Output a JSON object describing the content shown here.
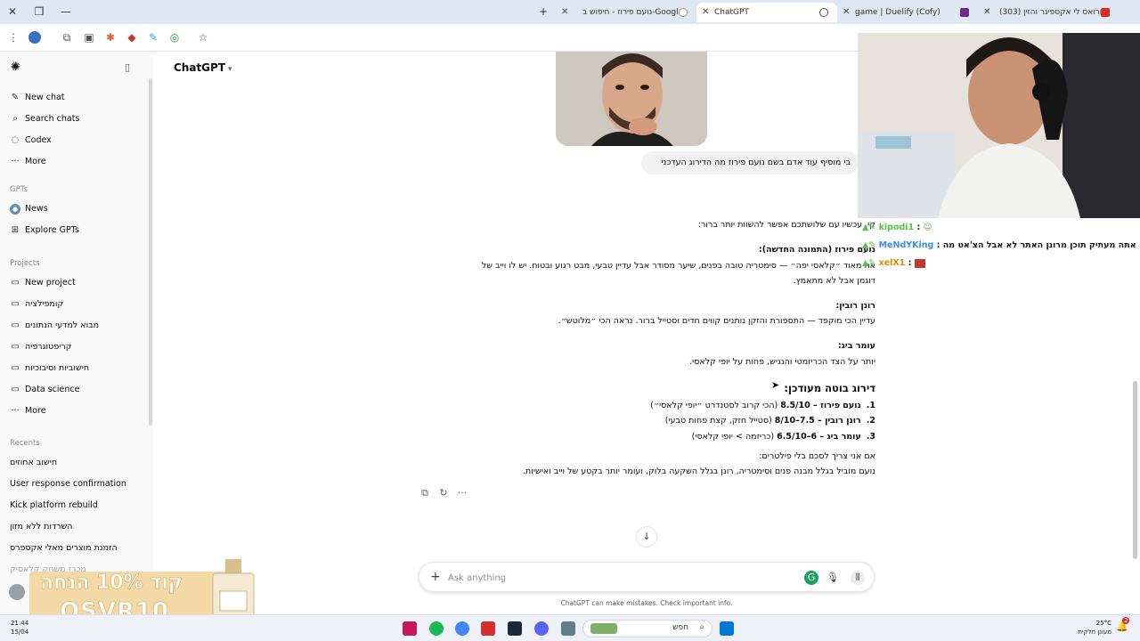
{
  "browser": {
    "tabs": [
      {
        "title": "נועם פירוז - חיפוש ב-Google",
        "active": false
      },
      {
        "title": "ChatGPT",
        "active": true
      },
      {
        "title": "game | Duelify (Cofy)",
        "active": false
      },
      {
        "title": "(303) קורואס לי אקספיגר והזין",
        "active": false
      }
    ]
  },
  "sidebar": {
    "top_items": [
      {
        "label": "New chat",
        "icon": "edit-icon"
      },
      {
        "label": "Search chats",
        "icon": "search-icon"
      },
      {
        "label": "Codex",
        "icon": "codex-icon"
      },
      {
        "label": "More",
        "icon": "more-icon"
      }
    ],
    "gpts_heading": "GPTs",
    "gpts": [
      {
        "label": "News"
      },
      {
        "label": "Explore GPTs"
      }
    ],
    "projects_heading": "Projects",
    "projects": [
      {
        "label": "New project"
      },
      {
        "label": "קומפילציה"
      },
      {
        "label": "מבוא למדעי הנתונים"
      },
      {
        "label": "קריפטוגרפיה"
      },
      {
        "label": "חישוביות וסיבוכיות"
      },
      {
        "label": "Data science"
      },
      {
        "label": "More"
      }
    ],
    "recents_heading": "Recents",
    "recents": [
      "חישוב אחוזים",
      "User response confirmation",
      "Kick platform rebuild",
      "השרדות ללא מזון",
      "הזמנת מוצרים מאלי אקספרס",
      "מכרז משחק קלאסיק"
    ]
  },
  "header": {
    "title": "ChatGPT"
  },
  "conversation": {
    "user_message": "בי מוסיף עוד אדם בשם נועם פירוז מה הדירוג העדכני",
    "assistant": {
      "intro": "קי, עכשיו עם שלושתכם אפשר להשוות יותר ברור:",
      "p1_title": "נועם פירוז (התמונה החדשה):",
      "p1_line1": "אה מאוד ״קלאסי יפה״ — סימטריה טובה בפנים, שיער מסודר אבל עדיין טבעי, מבט רגוע ובטוח. יש לו וייב של",
      "p1_line2": "דוגמן אבל לא מתאמץ.",
      "p2_title": "רונן רובין:",
      "p2_line1": "עדיין הכי מוקפד — התספורת והזקן נותנים קווים חדים וסטייל ברור. נראה הכי ״מלוטש״.",
      "p3_title": "עומר ביג:",
      "p3_line1": "יותר על הצד הכריזמטי והנגיש, פחות על יופי קלאסי.",
      "ranking_title": "דירוג בוטה מעודכן:",
      "ranking": [
        {
          "num": "1.",
          "name": "נועם פירוז – 8.5/10",
          "note": "(הכי קרוב לסטנדרט ״יופי קלאסי״)"
        },
        {
          "num": "2.",
          "name": "רונן רובין – 7.5–8/10",
          "note": "(סטייל חזק, קצת פחות טבעי)"
        },
        {
          "num": "3.",
          "name": "עומר ביג – 6–6.5/10",
          "note": "(כריזמה > יופי קלאסי)"
        }
      ],
      "summary_line1": "אם אני צריך לסכם בלי פילטרים:",
      "summary_line2": "נועם מוביל בגלל מבנה פנים וסימטריה, רונן בגלל השקעה בלוק, ועומר יותר בקטע של וייב ואישיות."
    }
  },
  "composer": {
    "placeholder": "Ask anything",
    "disclaimer": "ChatGPT can make mistakes. Check important info."
  },
  "stream_chat": [
    {
      "user": "kipodi1",
      "message": "",
      "color": "#53c24a"
    },
    {
      "user": "MeNdYKing",
      "message": "זה אתה מעתיק תוכן מרונן האתר לא אבל הצ'אט מה",
      "color": "#3a8ee6"
    },
    {
      "user": "xelX1",
      "message": "",
      "color": "#e08a00"
    }
  ],
  "promo": {
    "line1": "קוד 10% הנחה",
    "line2": "OSVR10"
  },
  "taskbar": {
    "time": "21:44",
    "date": "15/04",
    "search_label": "חפש",
    "weather_temp": "25°C",
    "weather_desc": "מעונן חלקית",
    "notifications": "2"
  },
  "colors": {
    "sidebar_bg": "#f9f9f9",
    "bubble_bg": "#f2f2f2",
    "tabbar_bg": "#dfe7f3"
  }
}
